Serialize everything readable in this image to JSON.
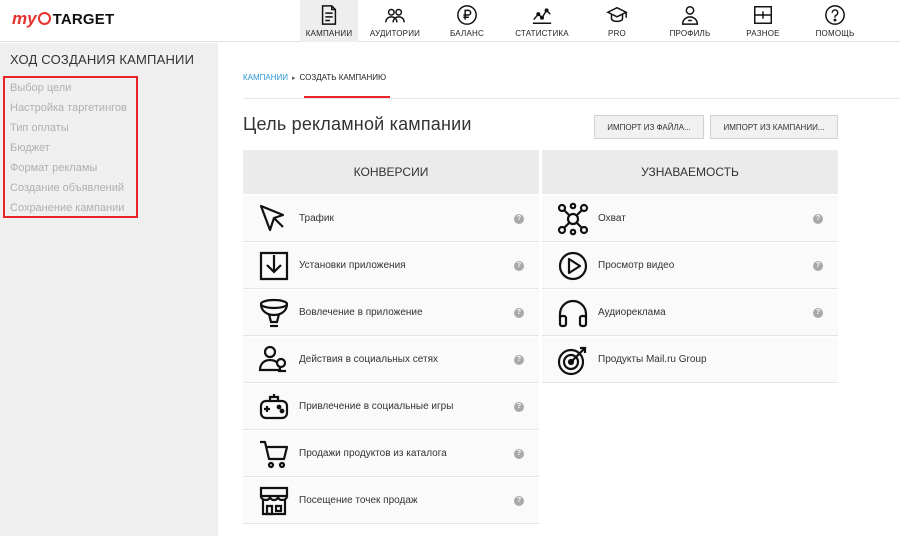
{
  "logo": {
    "my": "my",
    "target": "TARGET"
  },
  "nav": [
    {
      "label": "КАМПАНИИ",
      "icon": "document-icon"
    },
    {
      "label": "АУДИТОРИИ",
      "icon": "audience-icon"
    },
    {
      "label": "БАЛАНС",
      "icon": "ruble-icon"
    },
    {
      "label": "СТАТИСТИКА",
      "icon": "chart-icon"
    },
    {
      "label": "PRO",
      "icon": "graduation-cap-icon"
    },
    {
      "label": "ПРОФИЛЬ",
      "icon": "profile-icon"
    },
    {
      "label": "РАЗНОЕ",
      "icon": "misc-icon"
    },
    {
      "label": "ПОМОЩЬ",
      "icon": "help-icon"
    }
  ],
  "sidebar": {
    "title": "ХОД СОЗДАНИЯ КАМПАНИИ",
    "steps": [
      "Выбор цели",
      "Настройка таргетингов",
      "Тип оплаты",
      "Бюджет",
      "Формат рекламы",
      "Создание объявлений",
      "Сохранение кампании"
    ]
  },
  "breadcrumb": {
    "link": "КАМПАНИИ",
    "separator": "▸",
    "current": "СОЗДАТЬ КАМПАНИЮ"
  },
  "page_title": "Цель рекламной кампании",
  "buttons": {
    "import_file": "ИМПОРТ ИЗ ФАЙЛА...",
    "import_campaign": "ИМПОРТ ИЗ КАМПАНИИ..."
  },
  "columns": {
    "conversions": {
      "title": "КОНВЕРСИИ",
      "items": [
        {
          "label": "Трафик",
          "icon": "cursor-icon"
        },
        {
          "label": "Установки приложения",
          "icon": "download-box-icon"
        },
        {
          "label": "Вовлечение в приложение",
          "icon": "funnel-icon"
        },
        {
          "label": "Действия в социальных сетях",
          "icon": "social-actions-icon"
        },
        {
          "label": "Привлечение в социальные игры",
          "icon": "gamepad-icon"
        },
        {
          "label": "Продажи продуктов из каталога",
          "icon": "cart-icon"
        },
        {
          "label": "Посещение точек продаж",
          "icon": "store-icon"
        }
      ]
    },
    "awareness": {
      "title": "УЗНАВАЕМОСТЬ",
      "items": [
        {
          "label": "Охват",
          "icon": "reach-icon"
        },
        {
          "label": "Просмотр видео",
          "icon": "play-icon"
        },
        {
          "label": "Аудиореклама",
          "icon": "headphones-icon"
        },
        {
          "label": "Продукты Mail.ru Group",
          "icon": "target-icon"
        }
      ]
    }
  },
  "help_glyph": "?",
  "colors": {
    "accent": "#e8242a",
    "link": "#2a96d4",
    "sidebar_bg": "#efefef"
  }
}
